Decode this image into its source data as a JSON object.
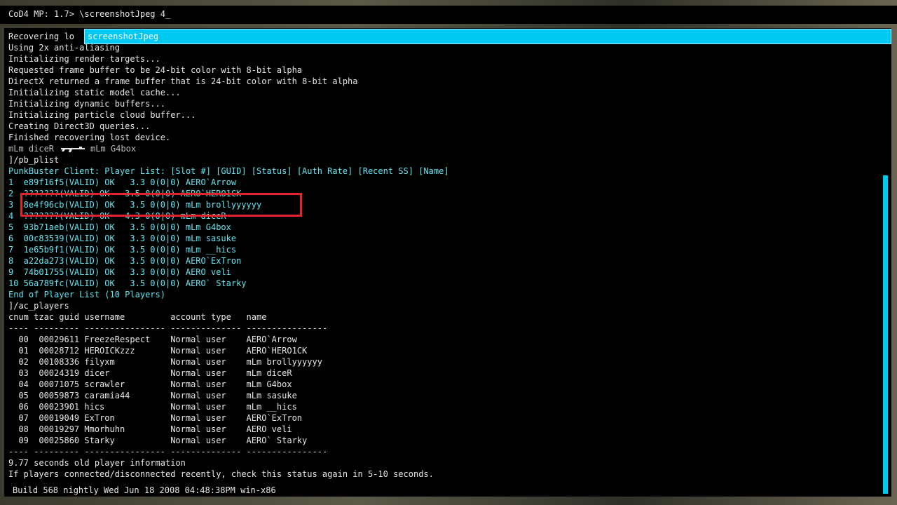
{
  "console_input": "CoD4 MP: 1.7> \\screenshotJpeg 4_",
  "autocomplete": "screenshotJpeg",
  "lines": [
    {
      "text": "Recovering lo",
      "color": "white"
    },
    {
      "text": "Using 2x anti-aliasing",
      "color": "white"
    },
    {
      "text": "Initializing render targets...",
      "color": "white"
    },
    {
      "text": "Requested frame buffer to be 24-bit color with 8-bit alpha",
      "color": "white"
    },
    {
      "text": "DirectX returned a frame buffer that is 24-bit color with 8-bit alpha",
      "color": "white"
    },
    {
      "text": "Initializing static model cache...",
      "color": "white"
    },
    {
      "text": "Initializing dynamic buffers...",
      "color": "white"
    },
    {
      "text": "Initializing particle cloud buffer...",
      "color": "white"
    },
    {
      "text": "Creating Direct3D queries...",
      "color": "white"
    },
    {
      "text": "Finished recovering lost device.",
      "color": "white"
    },
    {
      "text": "",
      "color": "gray",
      "kill": true
    },
    {
      "text": "]/pb_plist",
      "color": "white"
    },
    {
      "text": "PunkBuster Client: Player List: [Slot #] [GUID] [Status] [Auth Rate] [Recent SS] [Name]",
      "color": "cyan"
    },
    {
      "text": "1  e89f16f5(VALID) OK   3.3 0(0|0) AERO`Arrow",
      "color": "cyan"
    },
    {
      "text": "2  ???????(VALID) OK   3.5 0(0|0) AERO`HERO1CK",
      "color": "cyan"
    },
    {
      "text": "3  8e4f96cb(VALID) OK   3.5 0(0|0) mLm brollyyyyyy",
      "color": "cyan"
    },
    {
      "text": "4  ???????(VALID) OK   4.3 0(0|0) mLm diceR",
      "color": "cyan"
    },
    {
      "text": "5  93b71aeb(VALID) OK   3.5 0(0|0) mLm G4box",
      "color": "cyan"
    },
    {
      "text": "6  00c83539(VALID) OK   3.3 0(0|0) mLm sasuke",
      "color": "cyan"
    },
    {
      "text": "7  1e65b9f1(VALID) OK   3.5 0(0|0) mLm __hics",
      "color": "cyan"
    },
    {
      "text": "8  a22da273(VALID) OK   3.5 0(0|0) AERO`ExTron",
      "color": "cyan"
    },
    {
      "text": "9  74b01755(VALID) OK   3.3 0(0|0) AERO veli",
      "color": "cyan"
    },
    {
      "text": "10 56a789fc(VALID) OK   3.5 0(0|0) AERO` Starky",
      "color": "cyan"
    },
    {
      "text": "End of Player List (10 Players)",
      "color": "cyan"
    },
    {
      "text": "]/ac_players",
      "color": "white"
    },
    {
      "text": "cnum tzac guid username         account type   name",
      "color": "white"
    },
    {
      "text": "---- --------- ---------------- -------------- ----------------",
      "color": "white"
    },
    {
      "text": "  00  00029611 FreezeRespect    Normal user    AERO`Arrow",
      "color": "white"
    },
    {
      "text": "  01  00028712 HEROICKzzz       Normal user    AERO`HERO1CK",
      "color": "white"
    },
    {
      "text": "  02  00108336 filyxm           Normal user    mLm brollyyyyyy",
      "color": "white"
    },
    {
      "text": "  03  00024319 dicer            Normal user    mLm diceR",
      "color": "white"
    },
    {
      "text": "  04  00071075 scrawler         Normal user    mLm G4box",
      "color": "white"
    },
    {
      "text": "  05  00059873 caramia44        Normal user    mLm sasuke",
      "color": "white"
    },
    {
      "text": "  06  00023901 hics             Normal user    mLm __hics",
      "color": "white"
    },
    {
      "text": "  07  00019049 ExTron           Normal user    AERO`ExTron",
      "color": "white"
    },
    {
      "text": "  08  00019297 Mmorhuhn         Normal user    AERO veli",
      "color": "white"
    },
    {
      "text": "  09  00025860 Starky           Normal user    AERO` Starky",
      "color": "white"
    },
    {
      "text": "---- --------- ---------------- -------------- ----------------",
      "color": "white"
    },
    {
      "text": "9.77 seconds old player information",
      "color": "white"
    },
    {
      "text": "If players connected/disconnected recently, check this status again in 5-10 seconds.",
      "color": "white"
    }
  ],
  "kill_feed": {
    "killer": "mLm diceR",
    "victim": "mLm G4box"
  },
  "build_info": "Build 568 nightly Wed Jun 18 2008 04:48:38PM win-x86",
  "colors": {
    "cyan_text": "#62e3f0",
    "autocomplete_bg": "#00c8f0",
    "highlight": "#e0242a"
  }
}
